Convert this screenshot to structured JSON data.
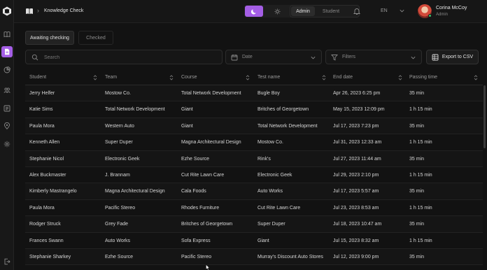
{
  "header": {
    "title": "Knowledge Check",
    "theme_dark": "moon-icon",
    "theme_light": "sun-icon",
    "roles": [
      "Admin",
      "Student"
    ],
    "active_role": "Admin",
    "language": "EN",
    "user": {
      "name": "Corina McCoy",
      "role": "Admin"
    }
  },
  "sidebar": {
    "items": [
      {
        "icon": "book-icon",
        "active": false
      },
      {
        "icon": "document-icon",
        "active": true
      },
      {
        "icon": "chart-icon",
        "active": false
      },
      {
        "icon": "users-icon",
        "active": false
      },
      {
        "icon": "list-icon",
        "active": false
      },
      {
        "icon": "location-icon",
        "active": false
      },
      {
        "icon": "settings-icon",
        "active": false
      }
    ],
    "logout_icon": "logout-icon"
  },
  "tabs": [
    {
      "label": "Awaiting checking",
      "active": true
    },
    {
      "label": "Checked",
      "active": false
    }
  ],
  "toolbar": {
    "search_placeholder": "Search",
    "date_label": "Date",
    "filters_label": "Filters",
    "export_label": "Export to CSV"
  },
  "table": {
    "columns": [
      "Student",
      "Team",
      "Course",
      "Test name",
      "End date",
      "Passing time"
    ],
    "rows": [
      [
        "Jerry Helfer",
        "Mostow Co.",
        "Total Network Development",
        "Bugle Boy",
        "Apr 26, 2023 6:25 pm",
        "35 min"
      ],
      [
        "Katie Sims",
        "Total Network Development",
        "Giant",
        "Britches of Georgetown",
        "May 15, 2023 12:09 pm",
        "1 h 15 min"
      ],
      [
        "Paula Mora",
        "Western Auto",
        "Giant",
        "Total Network Development",
        "Jul 17, 2023 7:23 pm",
        "35 min"
      ],
      [
        "Kenneth Allen",
        "Super Duper",
        "Magna Architectural Design",
        "Mostow Co.",
        "Jul 31, 2023 12:33 am",
        "1 h 15 min"
      ],
      [
        "Stephanie Nicol",
        "Electronic Geek",
        "Ezhe Source",
        "Rink's",
        "Jul 27, 2023 11:44 am",
        "35 min"
      ],
      [
        "Alex Buckmaster",
        "J. Brannam",
        "Cut Rite Lawn Care",
        "Electronic Geek",
        "Jul 29, 2023 2:10 pm",
        "1 h 15 min"
      ],
      [
        "Kimberly Mastrangelo",
        "Magna Architectural Design",
        "Cala Foods",
        "Auto Works",
        "Jul 17, 2023 5:57 am",
        "35 min"
      ],
      [
        "Paula Mora",
        "Pacific Stereo",
        "Rhodes Furniture",
        "Cut Rite Lawn Care",
        "Jul 23, 2023 8:53 am",
        "1 h 15 min"
      ],
      [
        "Rodger Struck",
        "Grey Fade",
        "Britches of Georgetown",
        "Super Duper",
        "Jul 18, 2023 10:47 am",
        "35 min"
      ],
      [
        "Frances Swann",
        "Auto Works",
        "Sofa Express",
        "Giant",
        "Jul 15, 2023 8:32 am",
        "1 h 15 min"
      ],
      [
        "Stephanie Sharkey",
        "Ezhe Source",
        "Pacific Stereo",
        "Murray's Discount Auto Stores",
        "Jul 12, 2023 9:00 pm",
        "35 min"
      ]
    ]
  },
  "colors": {
    "accent": "#a45ee5",
    "background": "#121212",
    "online": "#39c06b"
  }
}
